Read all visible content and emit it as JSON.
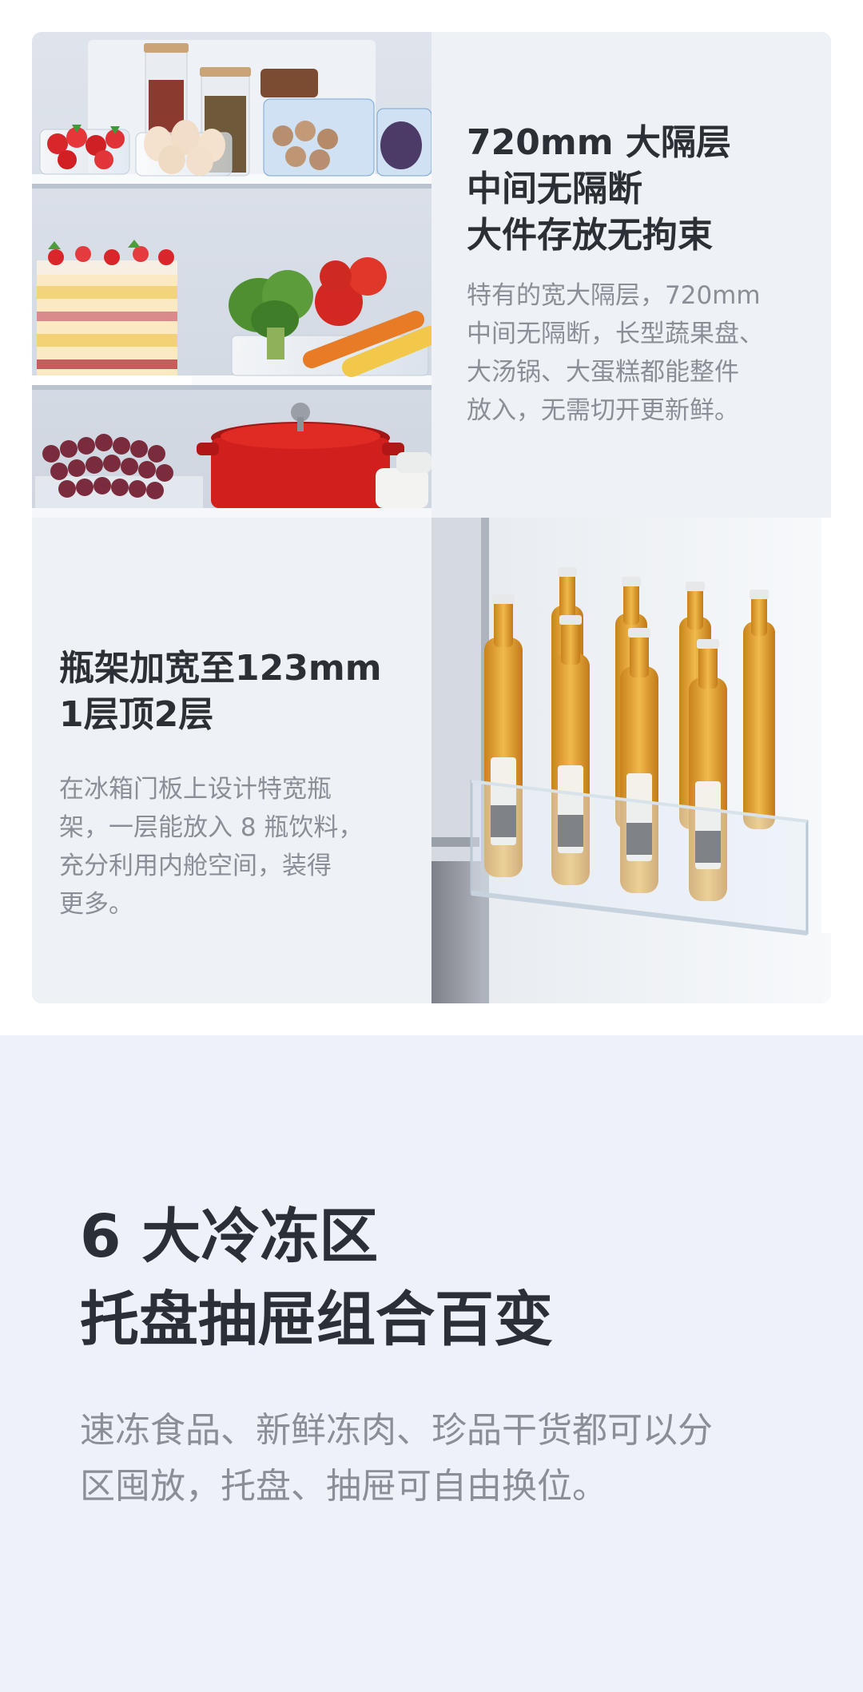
{
  "feature_wide_shelf": {
    "title_lines": [
      "720mm 大隔层",
      "中间无隔断",
      "大件存放无拘束"
    ],
    "desc_lines": [
      "特有的宽大隔层，720mm",
      "中间无隔断，长型蔬果盘、",
      "大汤锅、大蛋糕都能整件",
      "放入，无需切开更新鲜。"
    ]
  },
  "feature_bottle_rack": {
    "title_lines": [
      "瓶架加宽至123mm",
      "1层顶2层"
    ],
    "desc_lines": [
      "在冰箱门板上设计特宽瓶",
      "架，一层能放入 8 瓶饮料，",
      "充分利用内舱空间，装得",
      "更多。"
    ]
  },
  "freezer_section": {
    "heading_lines": [
      "6 大冷冻区",
      "托盘抽屉组合百变"
    ],
    "body_lines": [
      "速冻食品、新鲜冻肉、珍品干货都可以分",
      "区囤放，托盘、抽屉可自由换位。"
    ]
  },
  "colors": {
    "card_bg": "#eef1f6",
    "title": "#2b2f36",
    "body": "#8a8e96",
    "beer": "#e0a53a"
  }
}
